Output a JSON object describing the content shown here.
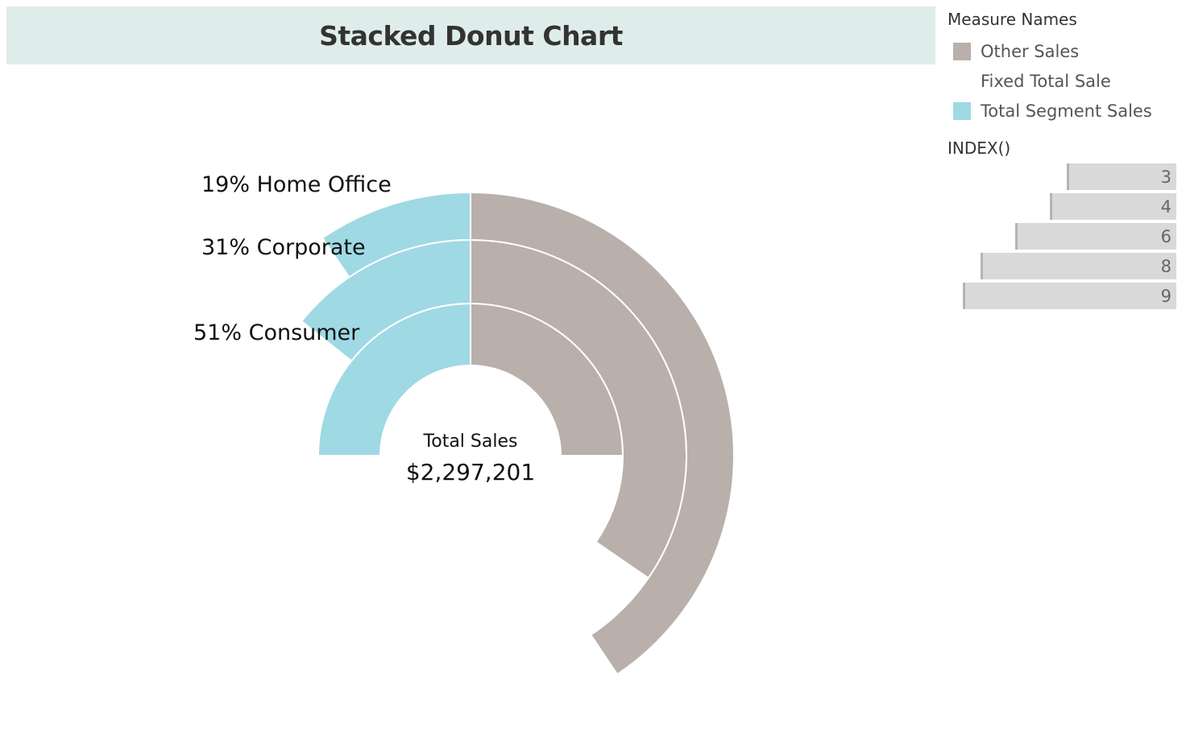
{
  "header": {
    "title": "Stacked Donut Chart"
  },
  "legend": {
    "title": "Measure Names",
    "items": [
      {
        "label": "Other Sales",
        "color": "#b9afab"
      },
      {
        "label": "Fixed Total Sale",
        "color": null
      },
      {
        "label": "Total Segment Sales",
        "color": "#9fd9e4"
      }
    ]
  },
  "index_filter": {
    "title": "INDEX()",
    "values": [
      {
        "label": "3",
        "value": 3
      },
      {
        "label": "4",
        "value": 4
      },
      {
        "label": "6",
        "value": 6
      },
      {
        "label": "8",
        "value": 8
      },
      {
        "label": "9",
        "value": 9
      }
    ],
    "max": 10
  },
  "chart_data": {
    "type": "pie",
    "title": "Stacked Donut Chart",
    "subtype": "stacked-donut",
    "center_label": {
      "title": "Total Sales",
      "value": "$2,297,201"
    },
    "colors": {
      "segment": "#9fd9e4",
      "other": "#b9afab"
    },
    "rings": [
      {
        "name": "Consumer",
        "label": "51% Consumer",
        "share_pct": 51,
        "segment_fraction": 0.25,
        "other_fraction": 0.25,
        "fixed_fraction": 0.5
      },
      {
        "name": "Corporate",
        "label": "31% Corporate",
        "share_pct": 31,
        "segment_fraction": 0.143,
        "other_fraction": 0.346,
        "fixed_fraction": 0.511
      },
      {
        "name": "Home Office",
        "label": "19% Home Office",
        "share_pct": 19,
        "segment_fraction": 0.095,
        "other_fraction": 0.406,
        "fixed_fraction": 0.499
      }
    ],
    "legend": [
      "Other Sales",
      "Fixed Total Sale",
      "Total Segment Sales"
    ]
  }
}
